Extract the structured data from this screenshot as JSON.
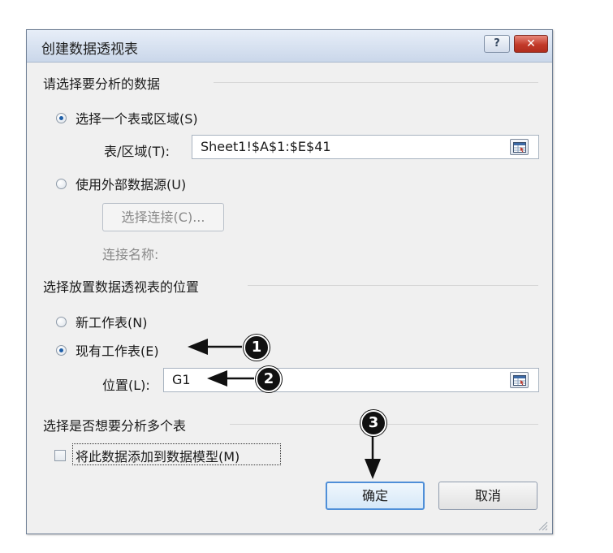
{
  "dialog": {
    "title": "创建数据透视表",
    "help_glyph": "?",
    "close_glyph": "✕"
  },
  "section_source": {
    "header": "请选择要分析的数据",
    "option_range_label": "选择一个表或区域(S)",
    "table_range_label": "表/区域(T):",
    "table_range_value": "Sheet1!$A$1:$E$41",
    "option_external_label": "使用外部数据源(U)",
    "choose_connection_button": "选择连接(C)...",
    "connection_name_label": "连接名称:"
  },
  "section_location": {
    "header": "选择放置数据透视表的位置",
    "option_new_sheet_label": "新工作表(N)",
    "option_existing_sheet_label": "现有工作表(E)",
    "location_label": "位置(L):",
    "location_value": "G1"
  },
  "section_multiple": {
    "header": "选择是否想要分析多个表",
    "add_to_model_label": "将此数据添加到数据模型(M)"
  },
  "buttons": {
    "ok": "确定",
    "cancel": "取消"
  },
  "annotations": {
    "callout_1": "1",
    "callout_2": "2",
    "callout_3": "3"
  },
  "state": {
    "selected_source": "range",
    "selected_location": "existing_sheet",
    "add_to_model_checked": false
  },
  "colors": {
    "accent": "#1f5fa8",
    "close_button": "#c23a2a",
    "default_button_border": "#4f8fd8"
  }
}
